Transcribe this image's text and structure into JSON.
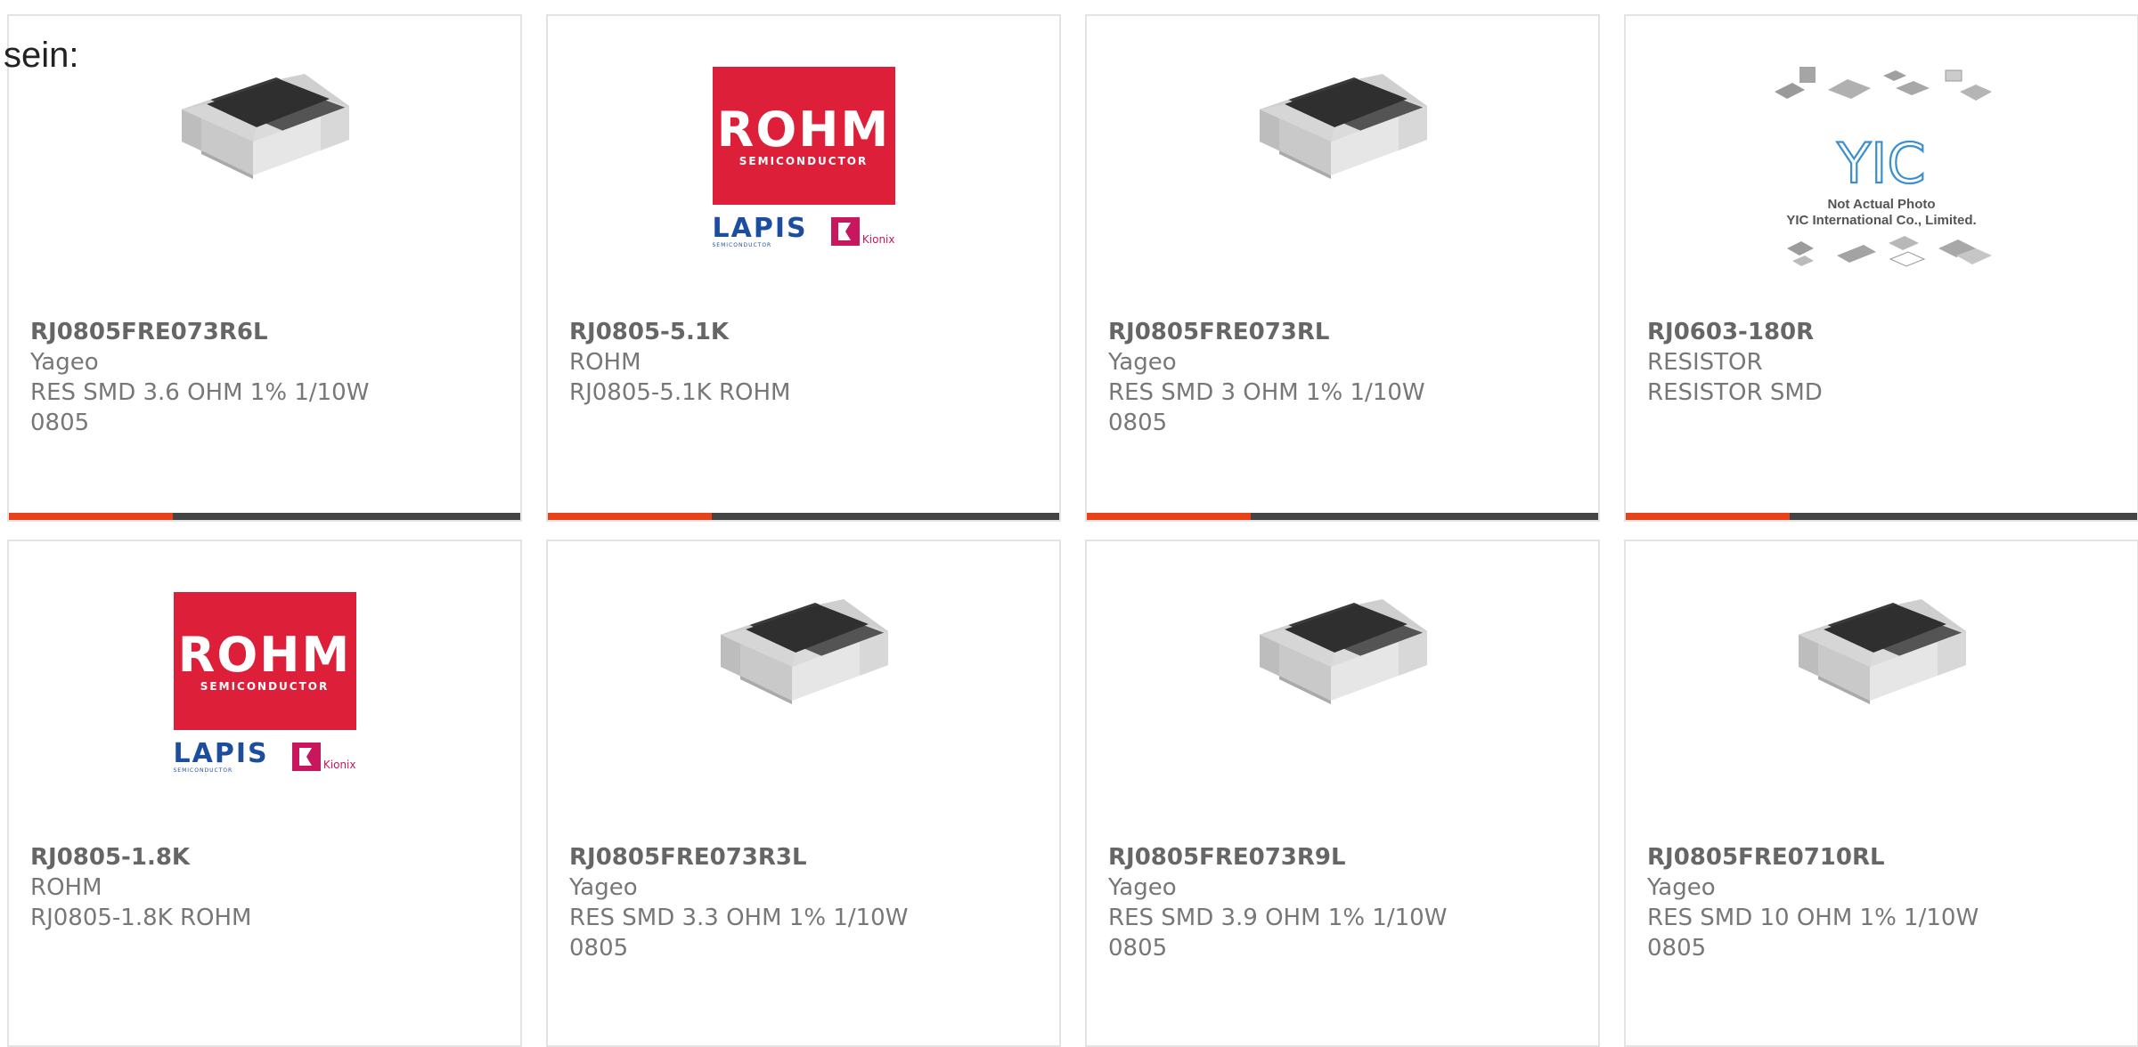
{
  "page_label": "sein:",
  "colors": {
    "accent": "#e8421b",
    "bar": "#444444",
    "rohm_red": "#dd1f3a",
    "lapis_blue": "#1d4e9e"
  },
  "products": [
    {
      "part_no": "RJ0805FRE073R6L",
      "maker": "Yageo",
      "description": "RES SMD 3.6 OHM 1% 1/10W 0805",
      "image": "smd-resistor"
    },
    {
      "part_no": "RJ0805-5.1K",
      "maker": "ROHM",
      "description": "RJ0805-5.1K ROHM",
      "image": "rohm-logo"
    },
    {
      "part_no": "RJ0805FRE073RL",
      "maker": "Yageo",
      "description": "RES SMD 3 OHM 1% 1/10W 0805",
      "image": "smd-resistor"
    },
    {
      "part_no": "RJ0603-180R",
      "maker": "RESISTOR",
      "description": "RESISTOR SMD",
      "image": "yic-placeholder"
    },
    {
      "part_no": "RJ0805-1.8K",
      "maker": "ROHM",
      "description": "RJ0805-1.8K ROHM",
      "image": "rohm-logo"
    },
    {
      "part_no": "RJ0805FRE073R3L",
      "maker": "Yageo",
      "description": "RES SMD 3.3 OHM 1% 1/10W 0805",
      "image": "smd-resistor"
    },
    {
      "part_no": "RJ0805FRE073R9L",
      "maker": "Yageo",
      "description": "RES SMD 3.9 OHM 1% 1/10W 0805",
      "image": "smd-resistor"
    },
    {
      "part_no": "RJ0805FRE0710RL",
      "maker": "Yageo",
      "description": "RES SMD 10 OHM 1% 1/10W 0805",
      "image": "smd-resistor"
    }
  ],
  "logos": {
    "rohm": {
      "name": "ROHM",
      "sub": "SEMICONDUCTOR",
      "lapis": "LAPIS",
      "lapis_sub": "SEMICONDUCTOR",
      "kionix": "Kionix"
    },
    "yic": {
      "mark": "YIC",
      "caption_1": "Not Actual Photo",
      "caption_2": "YIC International Co., Limited."
    }
  }
}
